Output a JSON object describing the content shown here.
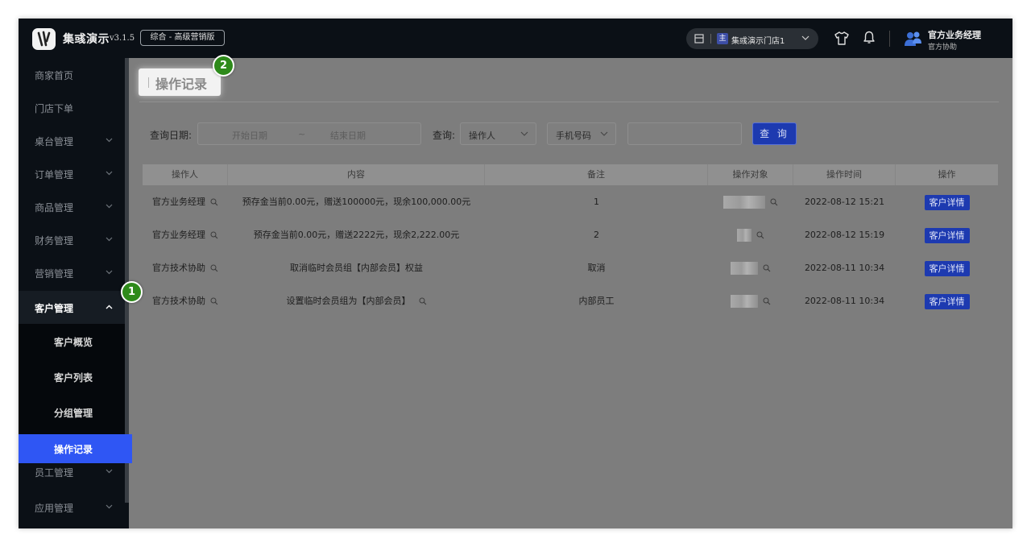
{
  "header": {
    "app_name": "集彧演示",
    "version": "v3.1.5",
    "edition": "综合 - 高级营销版",
    "store_tag": "主",
    "store_name": "集彧演示门店1",
    "user_name": "官方业务经理",
    "user_role": "官方协助"
  },
  "sidebar": {
    "items": [
      {
        "label": "商家首页",
        "has_chevron": false
      },
      {
        "label": "门店下单",
        "has_chevron": false
      },
      {
        "label": "桌台管理",
        "has_chevron": true
      },
      {
        "label": "订单管理",
        "has_chevron": true
      },
      {
        "label": "商品管理",
        "has_chevron": true
      },
      {
        "label": "财务管理",
        "has_chevron": true
      },
      {
        "label": "营销管理",
        "has_chevron": true
      },
      {
        "label": "客户管理",
        "has_chevron": true,
        "expanded": true
      }
    ],
    "sub_items": [
      {
        "label": "客户概览"
      },
      {
        "label": "客户列表"
      },
      {
        "label": "分组管理"
      },
      {
        "label": "操作记录",
        "active": true
      }
    ],
    "after_items": [
      {
        "label": "员工管理"
      },
      {
        "label": "应用管理"
      }
    ]
  },
  "page": {
    "title": "操作记录"
  },
  "markers": [
    "1",
    "2"
  ],
  "filters": {
    "date_label": "查询日期:",
    "start_placeholder": "开始日期",
    "range_sep": "~",
    "end_placeholder": "结束日期",
    "query_label": "查询:",
    "operator_select": "操作人",
    "phone_select": "手机号码",
    "search_value": "",
    "query_button": "查 询"
  },
  "table": {
    "columns": [
      "操作人",
      "内容",
      "备注",
      "操作对象",
      "操作时间",
      "操作"
    ],
    "rows": [
      {
        "operator": "官方业务经理",
        "content": "预存金当前0.00元，赠送100000元，现余100,000.00元",
        "remark": "1",
        "time": "2022-08-12 15:21",
        "action": "客户详情"
      },
      {
        "operator": "官方业务经理",
        "content": "预存金当前0.00元，赠送2222元，现余2,222.00元",
        "remark": "2",
        "time": "2022-08-12 15:19",
        "action": "客户详情"
      },
      {
        "operator": "官方技术协助",
        "content": "取消临时会员组【内部会员】权益",
        "remark": "取消",
        "time": "2022-08-11 10:34",
        "action": "客户详情"
      },
      {
        "operator": "官方技术协助",
        "content": "设置临时会员组为【内部会员】",
        "remark": "内部员工",
        "time": "2022-08-11 10:34",
        "action": "客户详情"
      }
    ]
  },
  "colors": {
    "accent": "#2f56f4",
    "button": "#1d3ab0",
    "marker": "#2e8a1b"
  }
}
